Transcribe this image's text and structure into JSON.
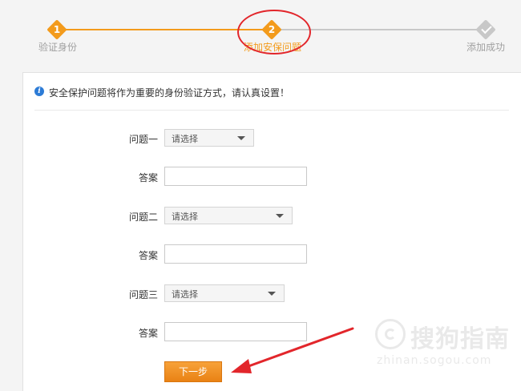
{
  "stepper": {
    "steps": [
      {
        "number": "1",
        "label": "验证身份",
        "state": "done"
      },
      {
        "number": "2",
        "label": "添加安保问题",
        "state": "active"
      },
      {
        "number": "",
        "label": "添加成功",
        "state": "pending",
        "icon": "check-icon"
      }
    ]
  },
  "notice": {
    "icon": "info-icon",
    "icon_glyph": "i",
    "text": "安全保护问题将作为重要的身份验证方式，请认真设置！"
  },
  "form": {
    "question1": {
      "label": "问题一",
      "placeholder": "请选择"
    },
    "answer1": {
      "label": "答案",
      "value": ""
    },
    "question2": {
      "label": "问题二",
      "placeholder": "请选择"
    },
    "answer2": {
      "label": "答案",
      "value": ""
    },
    "question3": {
      "label": "问题三",
      "placeholder": "请选择"
    },
    "answer3": {
      "label": "答案",
      "value": ""
    },
    "next_label": "下一步"
  },
  "colors": {
    "accent": "#f39b1c",
    "annotation": "#e2262b",
    "inactive": "#c8c8c8"
  },
  "watermark": {
    "brand": "搜狗指南",
    "url": "zhinan.sogou.com"
  }
}
